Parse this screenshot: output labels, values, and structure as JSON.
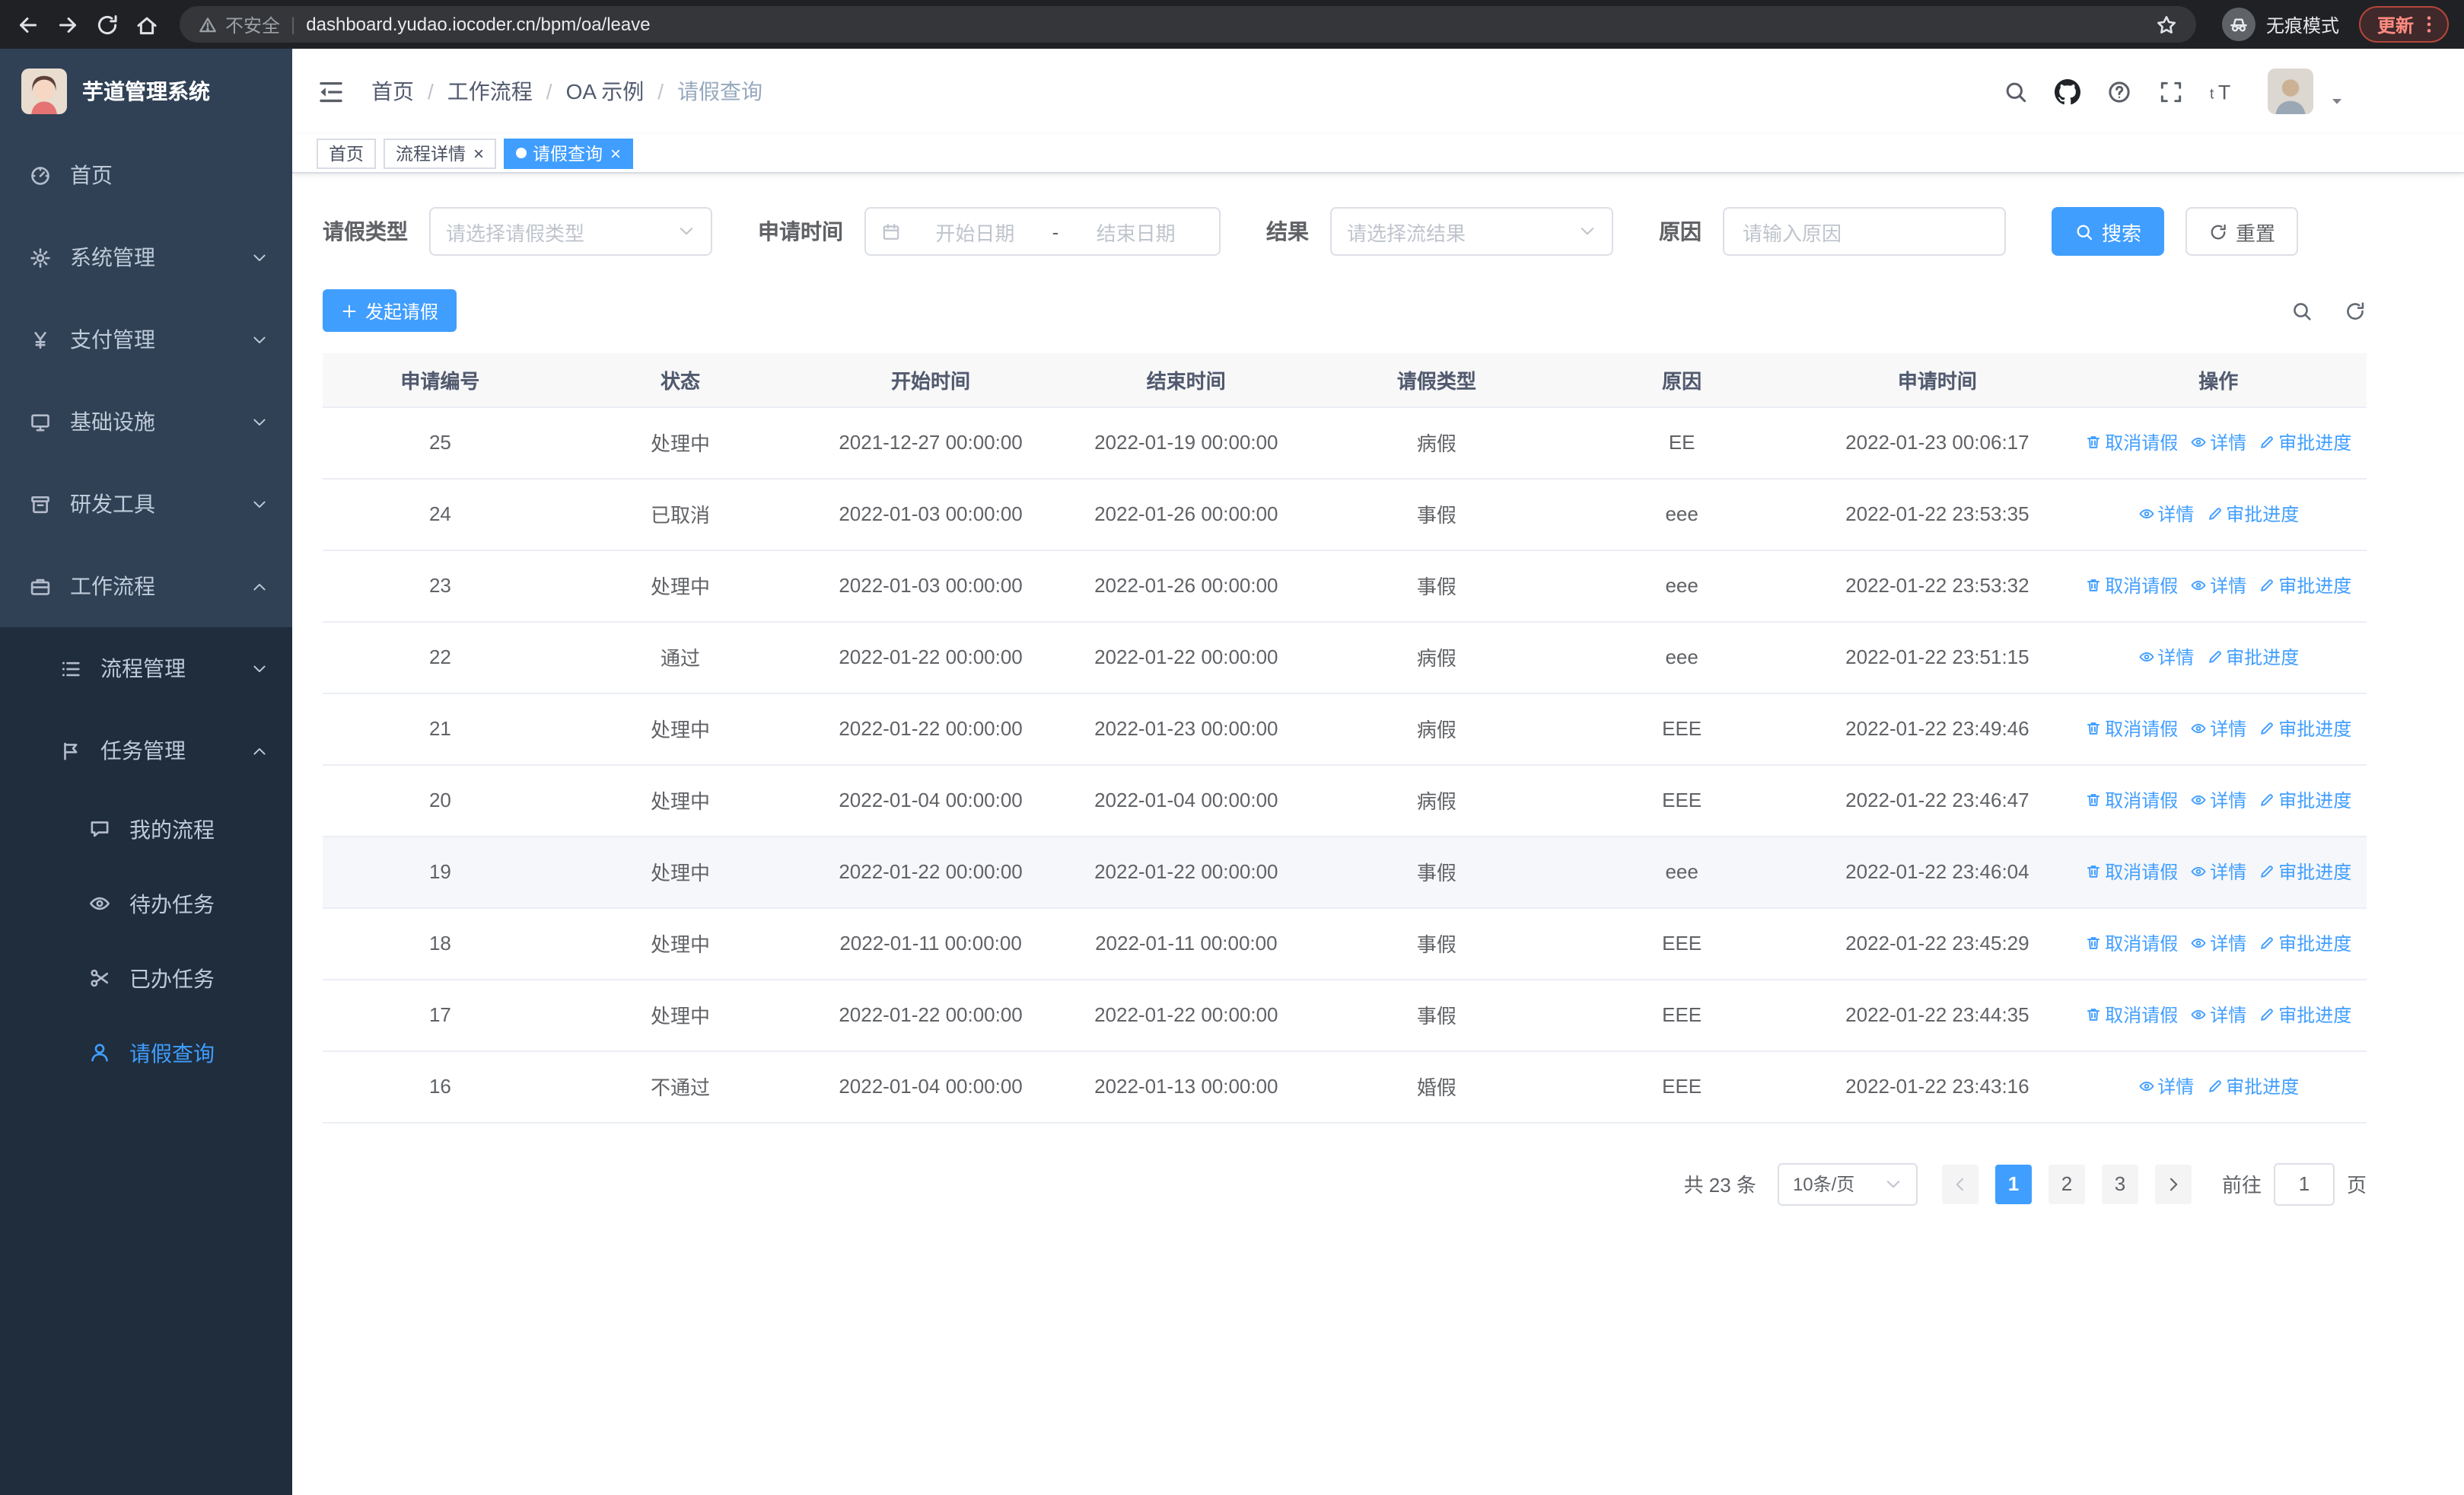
{
  "browser": {
    "url": "dashboard.yudao.iocoder.cn/bpm/oa/leave",
    "security_label": "不安全",
    "incognito_label": "无痕模式",
    "update_label": "更新"
  },
  "sidebar": {
    "logo_title": "芋道管理系统",
    "menu": [
      {
        "key": "home",
        "label": "首页",
        "icon": "dashboard",
        "level": 1
      },
      {
        "key": "system",
        "label": "系统管理",
        "icon": "gear",
        "level": 1,
        "arrow": "down"
      },
      {
        "key": "payment",
        "label": "支付管理",
        "icon": "yen",
        "level": 1,
        "arrow": "down"
      },
      {
        "key": "infra",
        "label": "基础设施",
        "icon": "infra",
        "level": 1,
        "arrow": "down"
      },
      {
        "key": "devtools",
        "label": "研发工具",
        "icon": "tool",
        "level": 1,
        "arrow": "down"
      },
      {
        "key": "workflow",
        "label": "工作流程",
        "icon": "briefcase",
        "level": 1,
        "arrow": "up"
      },
      {
        "key": "process-mgmt",
        "label": "流程管理",
        "icon": "list",
        "level": 2,
        "arrow": "down"
      },
      {
        "key": "task-mgmt",
        "label": "任务管理",
        "icon": "task",
        "level": 2,
        "arrow": "up"
      },
      {
        "key": "my-process",
        "label": "我的流程",
        "icon": "chat",
        "level": 3
      },
      {
        "key": "todo-task",
        "label": "待办任务",
        "icon": "eye",
        "level": 3
      },
      {
        "key": "done-task",
        "label": "已办任务",
        "icon": "scissors",
        "level": 3
      },
      {
        "key": "leave-query",
        "label": "请假查询",
        "icon": "user",
        "level": 3,
        "active": true
      }
    ]
  },
  "header": {
    "breadcrumb": [
      "首页",
      "工作流程",
      "OA 示例",
      "请假查询"
    ]
  },
  "tabs": [
    {
      "label": "首页",
      "closable": false,
      "active": false
    },
    {
      "label": "流程详情",
      "closable": true,
      "active": false
    },
    {
      "label": "请假查询",
      "closable": true,
      "active": true
    }
  ],
  "filters": {
    "leave_type_label": "请假类型",
    "leave_type_placeholder": "请选择请假类型",
    "apply_time_label": "申请时间",
    "start_date_placeholder": "开始日期",
    "range_separator": "-",
    "end_date_placeholder": "结束日期",
    "result_label": "结果",
    "result_placeholder": "请选择流结果",
    "reason_label": "原因",
    "reason_placeholder": "请输入原因",
    "search_button": "搜索",
    "reset_button": "重置"
  },
  "toolbar": {
    "create_button": "发起请假"
  },
  "table": {
    "columns": [
      "申请编号",
      "状态",
      "开始时间",
      "结束时间",
      "请假类型",
      "原因",
      "申请时间",
      "操作"
    ],
    "action_labels": {
      "cancel": "取消请假",
      "detail": "详情",
      "progress": "审批进度"
    },
    "rows": [
      {
        "id": "25",
        "status": "处理中",
        "start": "2021-12-27 00:00:00",
        "end": "2022-01-19 00:00:00",
        "type": "病假",
        "reason": "EE",
        "applied": "2022-01-23 00:06:17",
        "cancellable": true
      },
      {
        "id": "24",
        "status": "已取消",
        "start": "2022-01-03 00:00:00",
        "end": "2022-01-26 00:00:00",
        "type": "事假",
        "reason": "eee",
        "applied": "2022-01-22 23:53:35",
        "cancellable": false
      },
      {
        "id": "23",
        "status": "处理中",
        "start": "2022-01-03 00:00:00",
        "end": "2022-01-26 00:00:00",
        "type": "事假",
        "reason": "eee",
        "applied": "2022-01-22 23:53:32",
        "cancellable": true
      },
      {
        "id": "22",
        "status": "通过",
        "start": "2022-01-22 00:00:00",
        "end": "2022-01-22 00:00:00",
        "type": "病假",
        "reason": "eee",
        "applied": "2022-01-22 23:51:15",
        "cancellable": false
      },
      {
        "id": "21",
        "status": "处理中",
        "start": "2022-01-22 00:00:00",
        "end": "2022-01-23 00:00:00",
        "type": "病假",
        "reason": "EEE",
        "applied": "2022-01-22 23:49:46",
        "cancellable": true
      },
      {
        "id": "20",
        "status": "处理中",
        "start": "2022-01-04 00:00:00",
        "end": "2022-01-04 00:00:00",
        "type": "病假",
        "reason": "EEE",
        "applied": "2022-01-22 23:46:47",
        "cancellable": true
      },
      {
        "id": "19",
        "status": "处理中",
        "start": "2022-01-22 00:00:00",
        "end": "2022-01-22 00:00:00",
        "type": "事假",
        "reason": "eee",
        "applied": "2022-01-22 23:46:04",
        "cancellable": true,
        "highlighted": true
      },
      {
        "id": "18",
        "status": "处理中",
        "start": "2022-01-11 00:00:00",
        "end": "2022-01-11 00:00:00",
        "type": "事假",
        "reason": "EEE",
        "applied": "2022-01-22 23:45:29",
        "cancellable": true
      },
      {
        "id": "17",
        "status": "处理中",
        "start": "2022-01-22 00:00:00",
        "end": "2022-01-22 00:00:00",
        "type": "事假",
        "reason": "EEE",
        "applied": "2022-01-22 23:44:35",
        "cancellable": true
      },
      {
        "id": "16",
        "status": "不通过",
        "start": "2022-01-04 00:00:00",
        "end": "2022-01-13 00:00:00",
        "type": "婚假",
        "reason": "EEE",
        "applied": "2022-01-22 23:43:16",
        "cancellable": false
      }
    ]
  },
  "pagination": {
    "total_text": "共 23 条",
    "page_size": "10条/页",
    "pages": [
      "1",
      "2",
      "3"
    ],
    "active_page": "1",
    "goto_label": "前往",
    "goto_value": "1",
    "page_label": "页"
  },
  "colors": {
    "primary": "#409eff",
    "sidebar_bg": "#304156",
    "sidebar_submenu_bg": "#1f2d3d",
    "active_tab_bg": "#409eff"
  }
}
